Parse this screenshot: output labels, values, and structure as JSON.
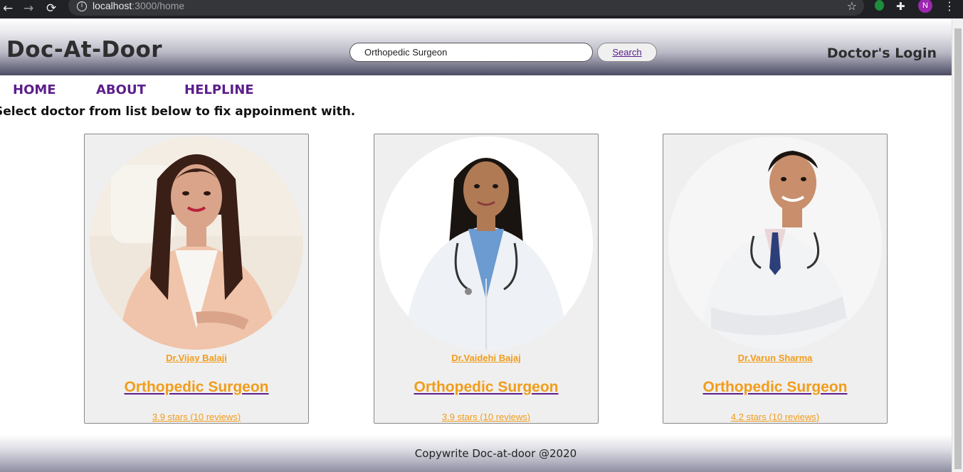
{
  "browser": {
    "url_host": "localhost",
    "url_path": ":3000/home",
    "back_icon": "←",
    "forward_icon": "→",
    "reload_icon": "⟳",
    "info_icon": "i",
    "star_icon": "☆",
    "puzzle_icon": "✚",
    "avatar_letter": "N",
    "menu_icon": "⋮"
  },
  "header": {
    "brand": "Doc-At-Door",
    "search_value": "Orthopedic Surgeon",
    "search_button": "Search",
    "doctor_login": "Doctor's Login"
  },
  "nav": {
    "items": [
      {
        "label": "HOME"
      },
      {
        "label": "ABOUT"
      },
      {
        "label": "HELPLINE"
      }
    ]
  },
  "instruction": "Select doctor from list below to fix appoinment with.",
  "doctors": [
    {
      "name": "Dr.Vijay Balaji",
      "specialty": "Orthopedic Surgeon",
      "rating": "3.9 stars (10 reviews)"
    },
    {
      "name": "Dr.Vaidehi Bajaj",
      "specialty": "Orthopedic Surgeon",
      "rating": "3.9 stars (10 reviews)"
    },
    {
      "name": "Dr.Varun Sharma",
      "specialty": "Orthopedic Surgeon",
      "rating": "4.2 stars (10 reviews)"
    }
  ],
  "footer": {
    "copyright": "Copywrite Doc-at-door @2020"
  },
  "colors": {
    "accent_orange": "#f29c1a",
    "nav_purple": "#5b1e8b",
    "header_dark": "#4b4b63"
  }
}
